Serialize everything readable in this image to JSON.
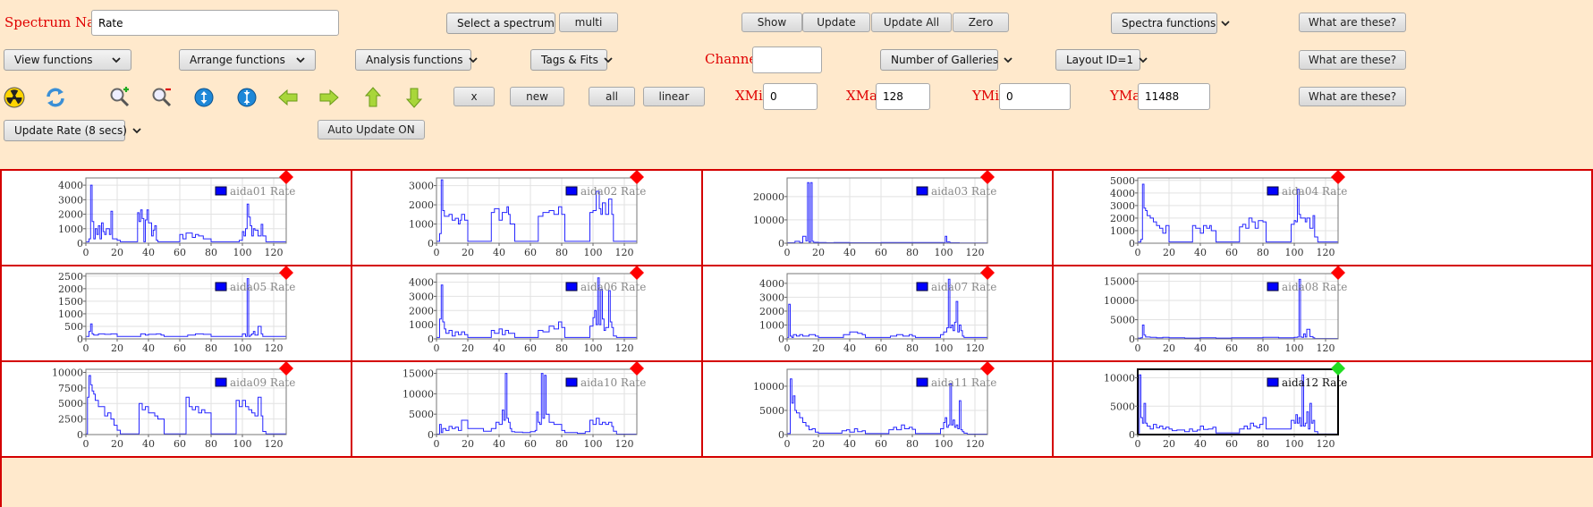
{
  "spectrum_name": {
    "label": "Spectrum Name:",
    "value": "Rate"
  },
  "row1": {
    "select_spectrum": "Select a spectrum",
    "multi": "multi",
    "show": "Show",
    "update": "Update",
    "update_all": "Update All",
    "zero": "Zero",
    "spectra_functions": "Spectra functions",
    "what": "What are these?"
  },
  "row2": {
    "view_functions": "View functions",
    "arrange_functions": "Arrange functions",
    "analysis_functions": "Analysis functions",
    "tags_fits": "Tags & Fits",
    "channel_label": "Channel:",
    "channel_value": "",
    "num_galleries": "Number of Galleries",
    "layout": "Layout ID=1",
    "what": "What are these?"
  },
  "row3": {
    "icons": [
      "radiation-icon",
      "refresh-icon",
      "zoom-in-icon",
      "zoom-out-icon",
      "expand-vertical-icon",
      "compress-vertical-icon",
      "arrow-left-icon",
      "arrow-right-icon",
      "arrow-up-icon",
      "arrow-down-icon"
    ],
    "x": "x",
    "new": "new",
    "all": "all",
    "linear": "linear",
    "xmin_label": "XMin",
    "xmin": "0",
    "xmax_label": "XMax",
    "xmax": "128",
    "ymin_label": "YMin",
    "ymin": "0",
    "ymax_label": "YMax",
    "ymax": "11488",
    "what": "What are these?"
  },
  "row4": {
    "update_rate": "Update Rate (8 secs)",
    "auto_update": "Auto Update ON"
  },
  "colors": {
    "accent_red": "#d40000",
    "series": "#0000ff",
    "marker_red": "#ff0000",
    "marker_green": "#22dd22",
    "background": "#ffe9cc"
  },
  "chart_data": [
    {
      "type": "line",
      "legend": "aida01 Rate",
      "marker": "red",
      "xlim": [
        0,
        128
      ],
      "ylim": [
        0,
        4500
      ],
      "yticks": [
        0,
        1000,
        2000,
        3000,
        4000
      ],
      "xticks": [
        0,
        20,
        40,
        60,
        80,
        100,
        120
      ],
      "x": [
        0,
        2,
        3,
        4,
        5,
        6,
        7,
        8,
        9,
        10,
        11,
        12,
        13,
        15,
        16,
        17,
        20,
        22,
        25,
        32,
        33,
        34,
        35,
        36,
        37,
        38,
        39,
        40,
        42,
        43,
        44,
        45,
        46,
        47,
        60,
        62,
        63,
        64,
        68,
        70,
        72,
        75,
        80,
        82,
        98,
        100,
        101,
        102,
        103,
        104,
        105,
        106,
        107,
        108,
        110,
        112,
        113,
        115
      ],
      "y": [
        100,
        300,
        4000,
        1500,
        300,
        1000,
        600,
        1200,
        300,
        1400,
        800,
        600,
        1000,
        600,
        2200,
        300,
        200,
        100,
        100,
        100,
        2100,
        1500,
        2300,
        1700,
        100,
        1600,
        2300,
        1400,
        500,
        900,
        1200,
        200,
        100,
        100,
        600,
        300,
        300,
        700,
        400,
        600,
        500,
        300,
        100,
        100,
        200,
        800,
        500,
        1000,
        2700,
        1800,
        1200,
        500,
        1000,
        900,
        500,
        1300,
        500,
        100
      ]
    },
    {
      "type": "line",
      "legend": "aida02 Rate",
      "marker": "red",
      "xlim": [
        0,
        128
      ],
      "ylim": [
        0,
        3400
      ],
      "yticks": [
        0,
        1000,
        2000,
        3000
      ],
      "xticks": [
        0,
        20,
        40,
        60,
        80,
        100,
        120
      ],
      "x": [
        0,
        2,
        3,
        4,
        5,
        8,
        10,
        12,
        14,
        15,
        16,
        18,
        20,
        33,
        35,
        37,
        40,
        42,
        45,
        46,
        47,
        50,
        63,
        65,
        68,
        72,
        75,
        78,
        80,
        82,
        95,
        98,
        100,
        102,
        104,
        105,
        106,
        108,
        110,
        112,
        113,
        115
      ],
      "y": [
        100,
        500,
        3300,
        1700,
        1400,
        1500,
        1200,
        1300,
        1000,
        1200,
        1500,
        1200,
        100,
        100,
        1600,
        1800,
        1200,
        1600,
        1900,
        1500,
        1000,
        100,
        100,
        1400,
        1600,
        1700,
        1500,
        1900,
        1500,
        100,
        100,
        1600,
        1700,
        2700,
        1800,
        1500,
        2100,
        1500,
        2300,
        1500,
        100,
        100
      ]
    },
    {
      "type": "line",
      "legend": "aida03 Rate",
      "marker": "red",
      "xlim": [
        0,
        128
      ],
      "ylim": [
        0,
        28000
      ],
      "yticks": [
        0,
        10000,
        20000
      ],
      "xticks": [
        0,
        20,
        40,
        60,
        80,
        100,
        120
      ],
      "x": [
        0,
        5,
        8,
        10,
        12,
        13,
        14,
        15,
        16,
        17,
        18,
        20,
        25,
        30,
        40,
        60,
        80,
        100,
        101,
        102,
        103,
        104,
        110,
        128
      ],
      "y": [
        200,
        800,
        300,
        3000,
        1000,
        26000,
        500,
        26000,
        800,
        300,
        400,
        300,
        200,
        300,
        200,
        300,
        300,
        200,
        3000,
        500,
        600,
        200,
        100,
        100
      ]
    },
    {
      "type": "line",
      "legend": "aida04 Rate",
      "marker": "red",
      "xlim": [
        0,
        128
      ],
      "ylim": [
        0,
        5200
      ],
      "yticks": [
        0,
        1000,
        2000,
        3000,
        4000,
        5000
      ],
      "xticks": [
        0,
        20,
        40,
        60,
        80,
        100,
        120
      ],
      "x": [
        0,
        2,
        3,
        4,
        5,
        6,
        8,
        10,
        12,
        14,
        16,
        18,
        20,
        33,
        35,
        37,
        40,
        42,
        44,
        46,
        47,
        50,
        63,
        65,
        67,
        69,
        71,
        73,
        75,
        77,
        80,
        82,
        95,
        98,
        100,
        101,
        102,
        103,
        104,
        106,
        107,
        108,
        110,
        112,
        113,
        115
      ],
      "y": [
        100,
        300,
        4700,
        2800,
        2600,
        2200,
        2000,
        1700,
        1400,
        1200,
        800,
        1400,
        100,
        100,
        1400,
        1200,
        800,
        1400,
        1200,
        1400,
        1000,
        100,
        100,
        1300,
        1500,
        1200,
        2000,
        1700,
        1200,
        1800,
        1700,
        100,
        100,
        1500,
        1800,
        1700,
        4300,
        2300,
        2000,
        2000,
        1700,
        2000,
        1200,
        2200,
        500,
        100
      ]
    },
    {
      "type": "line",
      "legend": "aida05 Rate",
      "marker": "red",
      "xlim": [
        0,
        128
      ],
      "ylim": [
        0,
        2600
      ],
      "yticks": [
        0,
        500,
        1000,
        1500,
        2000,
        2500
      ],
      "xticks": [
        0,
        20,
        40,
        60,
        80,
        100,
        120
      ],
      "x": [
        0,
        2,
        3,
        4,
        5,
        8,
        12,
        16,
        20,
        33,
        35,
        38,
        40,
        45,
        48,
        50,
        63,
        65,
        70,
        75,
        80,
        82,
        95,
        100,
        102,
        103,
        104,
        105,
        106,
        107,
        108,
        110,
        112,
        113,
        115
      ],
      "y": [
        100,
        300,
        600,
        200,
        150,
        200,
        180,
        200,
        100,
        100,
        200,
        150,
        180,
        200,
        150,
        100,
        100,
        150,
        200,
        180,
        100,
        100,
        100,
        200,
        100,
        2400,
        100,
        150,
        200,
        300,
        150,
        500,
        200,
        100,
        100
      ]
    },
    {
      "type": "line",
      "legend": "aida06 Rate",
      "marker": "red",
      "xlim": [
        0,
        128
      ],
      "ylim": [
        0,
        4600
      ],
      "yticks": [
        0,
        1000,
        2000,
        3000,
        4000
      ],
      "xticks": [
        0,
        20,
        40,
        60,
        80,
        100,
        120
      ],
      "x": [
        0,
        2,
        3,
        4,
        5,
        6,
        8,
        10,
        12,
        14,
        16,
        18,
        20,
        33,
        35,
        37,
        40,
        42,
        44,
        46,
        50,
        63,
        65,
        68,
        72,
        75,
        78,
        80,
        82,
        95,
        98,
        100,
        101,
        102,
        103,
        104,
        105,
        106,
        107,
        108,
        110,
        111,
        112,
        113,
        115
      ],
      "y": [
        100,
        1400,
        3800,
        1200,
        700,
        400,
        600,
        200,
        500,
        300,
        500,
        300,
        100,
        100,
        600,
        400,
        700,
        300,
        600,
        400,
        100,
        100,
        600,
        500,
        900,
        700,
        1200,
        800,
        100,
        100,
        900,
        1500,
        2000,
        1000,
        4300,
        1000,
        3500,
        1400,
        600,
        800,
        3400,
        1200,
        800,
        200,
        100
      ]
    },
    {
      "type": "line",
      "legend": "aida07 Rate",
      "marker": "red",
      "xlim": [
        0,
        128
      ],
      "ylim": [
        0,
        4700
      ],
      "yticks": [
        0,
        1000,
        2000,
        3000,
        4000
      ],
      "xticks": [
        0,
        20,
        40,
        60,
        80,
        100,
        120
      ],
      "x": [
        0,
        1,
        2,
        3,
        4,
        6,
        8,
        10,
        14,
        18,
        20,
        33,
        36,
        40,
        45,
        48,
        50,
        63,
        66,
        70,
        74,
        78,
        80,
        82,
        95,
        98,
        100,
        102,
        103,
        104,
        105,
        106,
        107,
        108,
        109,
        110,
        111,
        112,
        113,
        115
      ],
      "y": [
        100,
        2500,
        200,
        100,
        300,
        200,
        300,
        200,
        300,
        200,
        100,
        100,
        300,
        500,
        400,
        300,
        100,
        100,
        200,
        300,
        200,
        300,
        200,
        100,
        100,
        300,
        500,
        800,
        4300,
        800,
        1000,
        600,
        1200,
        2700,
        500,
        1000,
        600,
        200,
        100,
        100
      ]
    },
    {
      "type": "line",
      "legend": "aida08 Rate",
      "marker": "red",
      "xlim": [
        0,
        128
      ],
      "ylim": [
        0,
        17000
      ],
      "yticks": [
        0,
        5000,
        10000,
        15000
      ],
      "xticks": [
        0,
        20,
        40,
        60,
        80,
        100,
        120
      ],
      "x": [
        0,
        2,
        3,
        4,
        5,
        8,
        12,
        16,
        20,
        30,
        40,
        50,
        60,
        70,
        80,
        90,
        100,
        102,
        103,
        104,
        105,
        106,
        107,
        108,
        110,
        112,
        113,
        115
      ],
      "y": [
        200,
        300,
        3600,
        1000,
        500,
        400,
        300,
        400,
        300,
        200,
        300,
        200,
        300,
        300,
        400,
        300,
        400,
        500,
        15500,
        500,
        400,
        1300,
        500,
        2500,
        600,
        300,
        100,
        100
      ]
    },
    {
      "type": "line",
      "legend": "aida09 Rate",
      "marker": "red",
      "xlim": [
        0,
        128
      ],
      "ylim": [
        0,
        10500
      ],
      "yticks": [
        0,
        2500,
        5000,
        7500,
        10000
      ],
      "xticks": [
        0,
        20,
        40,
        60,
        80,
        100,
        120
      ],
      "x": [
        0,
        1,
        2,
        3,
        4,
        5,
        6,
        8,
        10,
        12,
        14,
        16,
        18,
        20,
        22,
        33,
        34,
        36,
        38,
        40,
        42,
        44,
        46,
        48,
        50,
        63,
        64,
        66,
        68,
        70,
        72,
        74,
        76,
        78,
        80,
        95,
        96,
        98,
        100,
        102,
        104,
        106,
        108,
        110,
        112,
        113,
        115
      ],
      "y": [
        100,
        6000,
        9500,
        8000,
        7000,
        6500,
        5500,
        4500,
        4500,
        3000,
        3500,
        2500,
        1500,
        700,
        100,
        100,
        5000,
        4000,
        4500,
        3500,
        3500,
        3000,
        2500,
        2500,
        100,
        100,
        6000,
        4500,
        4000,
        4500,
        3500,
        4000,
        3500,
        3500,
        100,
        100,
        5500,
        4500,
        5500,
        4500,
        4000,
        3500,
        3000,
        6000,
        3000,
        500,
        100
      ]
    },
    {
      "type": "line",
      "legend": "aida10 Rate",
      "marker": "red",
      "xlim": [
        0,
        128
      ],
      "ylim": [
        0,
        16000
      ],
      "yticks": [
        0,
        5000,
        10000,
        15000
      ],
      "xticks": [
        0,
        20,
        40,
        60,
        80,
        100,
        120
      ],
      "x": [
        0,
        2,
        3,
        4,
        6,
        8,
        10,
        12,
        14,
        16,
        20,
        30,
        35,
        38,
        40,
        42,
        43,
        44,
        45,
        46,
        47,
        48,
        50,
        55,
        60,
        63,
        64,
        65,
        66,
        67,
        68,
        69,
        70,
        72,
        75,
        80,
        82,
        90,
        95,
        98,
        100,
        102,
        104,
        106,
        108,
        110,
        112,
        113,
        115
      ],
      "y": [
        100,
        2500,
        500,
        1500,
        1000,
        2000,
        1500,
        1800,
        1000,
        3500,
        1500,
        800,
        1500,
        3000,
        2500,
        6000,
        3500,
        15000,
        4000,
        3000,
        1500,
        700,
        600,
        500,
        700,
        1000,
        5500,
        3000,
        2500,
        15000,
        4000,
        14500,
        5000,
        3000,
        2500,
        1000,
        500,
        300,
        700,
        3500,
        2500,
        4000,
        2500,
        3000,
        2500,
        3000,
        2000,
        800,
        100
      ]
    },
    {
      "type": "line",
      "legend": "aida11 Rate",
      "marker": "red",
      "xlim": [
        0,
        128
      ],
      "ylim": [
        0,
        13500
      ],
      "yticks": [
        0,
        5000,
        10000
      ],
      "xticks": [
        0,
        20,
        40,
        60,
        80,
        100,
        120
      ],
      "x": [
        0,
        2,
        3,
        4,
        5,
        6,
        8,
        10,
        12,
        14,
        16,
        18,
        20,
        33,
        35,
        38,
        40,
        43,
        45,
        48,
        50,
        63,
        65,
        68,
        70,
        73,
        75,
        78,
        80,
        82,
        95,
        98,
        100,
        101,
        102,
        103,
        104,
        105,
        106,
        107,
        108,
        109,
        110,
        111,
        112,
        113,
        115
      ],
      "y": [
        200,
        11500,
        6500,
        8000,
        5000,
        4500,
        3500,
        2500,
        1800,
        1000,
        1200,
        500,
        300,
        300,
        800,
        1000,
        500,
        1200,
        600,
        800,
        200,
        200,
        1000,
        1500,
        1000,
        2000,
        1200,
        1500,
        1100,
        200,
        200,
        1200,
        2500,
        3500,
        1500,
        2000,
        10500,
        2000,
        3000,
        1500,
        2000,
        1200,
        7000,
        1000,
        600,
        300,
        100
      ]
    },
    {
      "type": "line",
      "legend": "aida12 Rate",
      "marker": "green",
      "xlim": [
        0,
        128
      ],
      "ylim": [
        0,
        11500
      ],
      "yticks": [
        0,
        5000,
        10000
      ],
      "xticks": [
        0,
        20,
        40,
        60,
        80,
        100,
        120
      ],
      "x": [
        0,
        1,
        2,
        3,
        4,
        5,
        6,
        8,
        10,
        12,
        14,
        16,
        18,
        20,
        22,
        25,
        30,
        33,
        35,
        38,
        40,
        42,
        45,
        48,
        50,
        63,
        65,
        68,
        70,
        72,
        74,
        76,
        78,
        80,
        82,
        95,
        98,
        100,
        101,
        102,
        103,
        104,
        105,
        106,
        107,
        108,
        109,
        110,
        111,
        112,
        113,
        115
      ],
      "y": [
        300,
        10500,
        3000,
        2000,
        5500,
        2000,
        1500,
        1000,
        1800,
        1200,
        1500,
        1000,
        1300,
        1000,
        700,
        800,
        500,
        1000,
        600,
        800,
        1500,
        900,
        1000,
        1300,
        300,
        300,
        1000,
        1500,
        1000,
        2000,
        1500,
        1200,
        1800,
        3000,
        1000,
        1000,
        2500,
        2000,
        3500,
        2000,
        3000,
        1500,
        10500,
        1500,
        2000,
        4000,
        1000,
        5500,
        2000,
        2500,
        500,
        100
      ]
    }
  ]
}
